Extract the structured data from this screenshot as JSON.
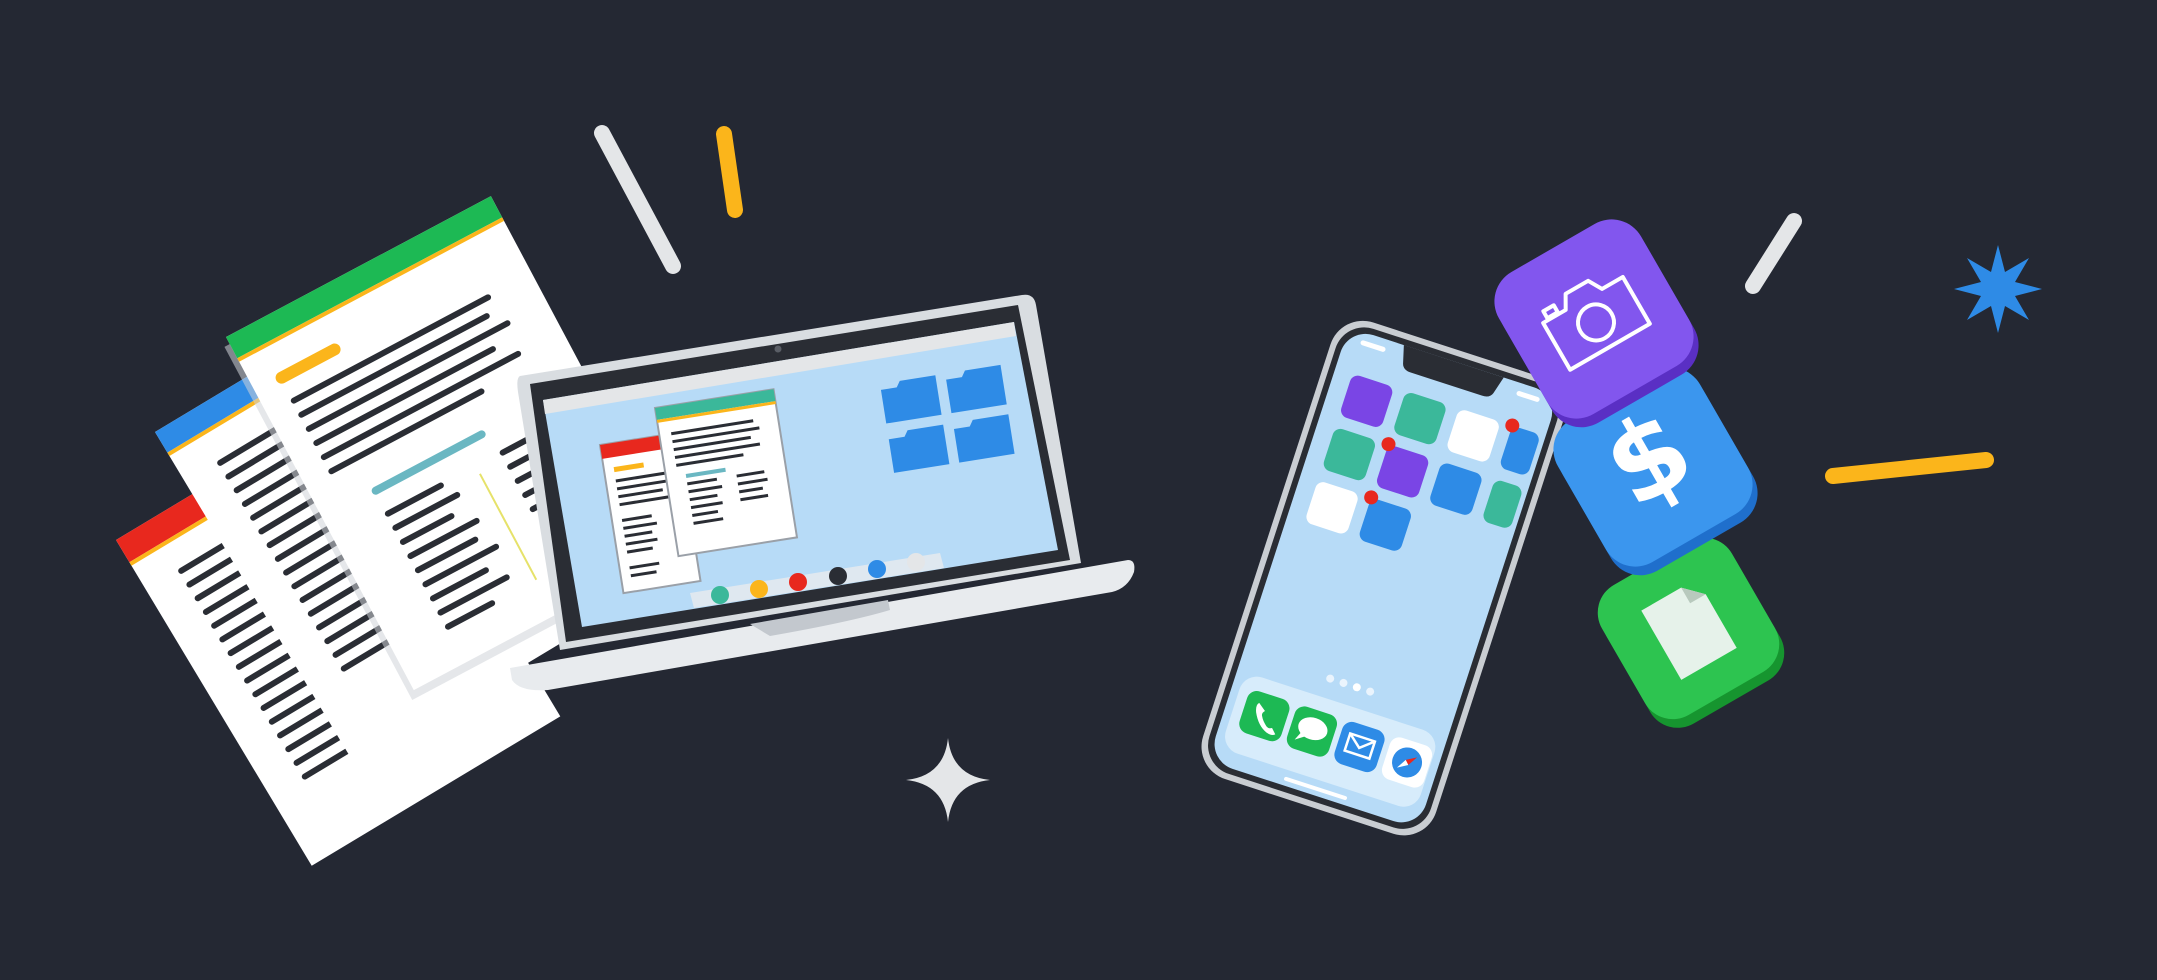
{
  "scene": {
    "description_visible_text": "",
    "palette": {
      "background": "#242833",
      "paper": "#ffffff",
      "paper_shadow": "#cfd3d8",
      "text_lines": "#2a2d34",
      "screen": "#b7dbf7",
      "laptop_body": "#e8ebee",
      "green": "#1db954",
      "blue": "#2e8be6",
      "red": "#e8281e",
      "yellow": "#fbb51b",
      "teal": "#3bb89a",
      "purple": "#7a45e5",
      "light_gray": "#e4e6e8"
    },
    "icons": [
      "document-icon",
      "laptop-icon",
      "smartphone-icon",
      "camera-app-icon",
      "dollar-app-icon",
      "file-app-icon",
      "phone-icon",
      "messages-icon",
      "mail-icon",
      "compass-icon",
      "folder-icon",
      "sparkle-icon",
      "star-burst-icon"
    ],
    "dock_dot_colors": [
      "#3bb89a",
      "#fbb51b",
      "#e8281e",
      "#2a2d34",
      "#2e8be6",
      "#e4e6e8"
    ],
    "phone_page_indicator_count": 4
  }
}
